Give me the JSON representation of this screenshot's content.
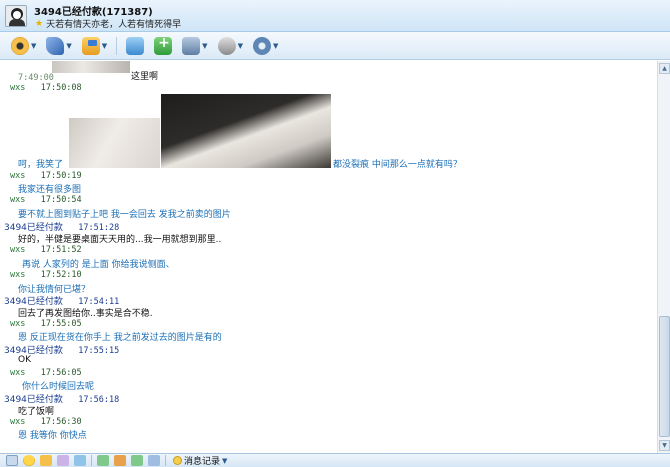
{
  "header": {
    "contact_name": "3494已经付款(171387)",
    "signature": "天若有情天亦老，人若有情死得早"
  },
  "toolbar": {
    "buttons": [
      {
        "name": "video-icon"
      },
      {
        "name": "voice-icon"
      },
      {
        "name": "file-transfer-icon"
      },
      {
        "name": "picture-icon"
      },
      {
        "name": "add-app-icon"
      },
      {
        "name": "briefcase-icon"
      },
      {
        "name": "remote-assist-icon"
      },
      {
        "name": "settings-gear-icon"
      }
    ]
  },
  "messages": [
    {
      "top_text_fragment": "7:49:00",
      "text": "这里啊"
    },
    {
      "sender": "wxs",
      "time": "17:50:08"
    },
    {
      "text_left": "呵，我笑了",
      "text_right": "都没裂痕  中间那么一点就有吗？"
    },
    {
      "sender": "wxs",
      "time": "17:50:19",
      "text": "我家还有很多图"
    },
    {
      "sender": "wxs",
      "time": "17:50:54",
      "text": "要不就上图到贴子上吧  我一会回去  发我之前卖的图片"
    },
    {
      "sender": "3494已经付款",
      "time": "17:51:28",
      "text": "好的，半健是要桌面天天用的...我一用就想到那里.."
    },
    {
      "sender": "wxs",
      "time": "17:51:52",
      "text": "再说  人家列的  是上面  你给我说侧面、"
    },
    {
      "sender": "wxs",
      "time": "17:52:10",
      "text": "你让我情何已堪？"
    },
    {
      "sender": "3494已经付款",
      "time": "17:54:11",
      "text": "回去了再发图给你..事实是合不稳."
    },
    {
      "sender": "wxs",
      "time": "17:55:05",
      "text": "恩  反正现在货在你手上     我之前发过去的图片是有的"
    },
    {
      "sender": "3494已经付款",
      "time": "17:55:15",
      "text": "OK"
    },
    {
      "sender": "wxs",
      "time": "17:56:05",
      "text": "你什么时候回去呢"
    },
    {
      "sender": "3494已经付款",
      "time": "17:56:18",
      "text": "吃了饭啊"
    },
    {
      "sender": "wxs",
      "time": "17:56:30",
      "text": "恩  我等你  你快点"
    }
  ],
  "bottombar": {
    "history_label": "消息记录"
  },
  "colors": {
    "self_sender": "#1b3d8f",
    "other_sender": "#2a7a3a",
    "other_message": "#1a6fb6",
    "self_message": "#111111"
  }
}
